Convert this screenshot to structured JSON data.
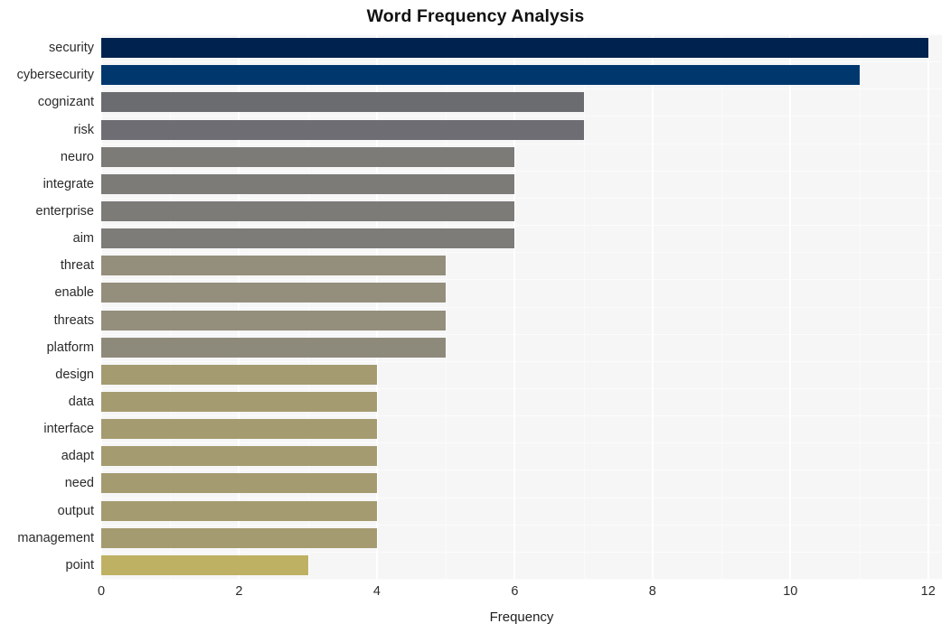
{
  "chart_data": {
    "type": "bar",
    "orientation": "horizontal",
    "title": "Word Frequency Analysis",
    "xlabel": "Frequency",
    "ylabel": "",
    "xlim": [
      0,
      12.2
    ],
    "xticks": [
      0,
      2,
      4,
      6,
      8,
      10,
      12
    ],
    "xtick_labels": [
      "0",
      "2",
      "4",
      "6",
      "8",
      "10",
      "12"
    ],
    "grid": true,
    "legend": null,
    "categories": [
      "security",
      "cybersecurity",
      "cognizant",
      "risk",
      "neuro",
      "integrate",
      "enterprise",
      "aim",
      "threat",
      "enable",
      "threats",
      "platform",
      "design",
      "data",
      "interface",
      "adapt",
      "need",
      "output",
      "management",
      "point"
    ],
    "values": [
      12,
      11,
      7,
      7,
      6,
      6,
      6,
      6,
      5,
      5,
      5,
      5,
      4,
      4,
      4,
      4,
      4,
      4,
      4,
      3
    ],
    "bar_colors": [
      "#00224e",
      "#00386e",
      "#6b6c70",
      "#6d6d73",
      "#7c7b78",
      "#7c7b78",
      "#7c7b78",
      "#7d7c79",
      "#948e7c",
      "#948e7c",
      "#948e7c",
      "#8e8a7b",
      "#a49b70",
      "#a49b70",
      "#a49b70",
      "#a49b70",
      "#a49b70",
      "#a49b70",
      "#a49b70",
      "#bfb163"
    ]
  },
  "theme": {
    "panel_background": "#f6f6f7",
    "figure_background": "#ffffff",
    "gridline_color": "#ffffff",
    "text_color": "#2b2b2b"
  }
}
